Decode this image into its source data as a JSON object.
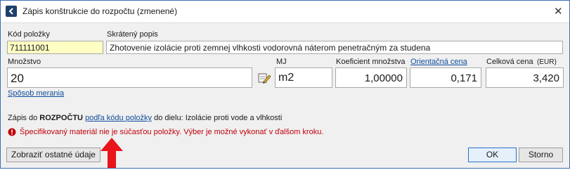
{
  "window": {
    "title": "Zápis konštrukcie do rozpočtu (zmenené)",
    "close_glyph": "✕"
  },
  "fields": {
    "kod_label": "Kód položky",
    "kod_value": "711111001",
    "popis_label": "Skrátený popis",
    "popis_value": "Zhotovenie izolácie proti zemnej vlhkosti vodorovná náterom penetračným za studena",
    "mnozstvo_label": "Množstvo",
    "mnozstvo_value": "20",
    "mj_label": "MJ",
    "mj_value": "m2",
    "koef_label": "Koeficient množstva",
    "koef_value": "1,00000",
    "cena_label": "Orientačná cena",
    "cena_value": "0,171",
    "celkova_label": "Celková cena",
    "celkova_unit": "(EUR)",
    "celkova_value": "3,420",
    "sposob_link": "Spôsob merania"
  },
  "info": {
    "prefix": "Zápis do",
    "rozpocet": "ROZPOČTU",
    "link": "podľa kódu položky",
    "suffix": "do dielu: Izolácie proti vode a vlhkosti"
  },
  "error": {
    "message": "Špecifikovaný materiál nie je súčasťou položky. Výber je možné vykonať v ďalšom kroku."
  },
  "buttons": {
    "zobrazit": "Zobraziť ostatné údaje",
    "ok": "OK",
    "storno": "Storno"
  },
  "colors": {
    "accent": "#1f3f6b",
    "link": "#0f4c9c",
    "error": "#c0000a",
    "arrow": "#e8151b",
    "highlight": "#ffffc4"
  }
}
